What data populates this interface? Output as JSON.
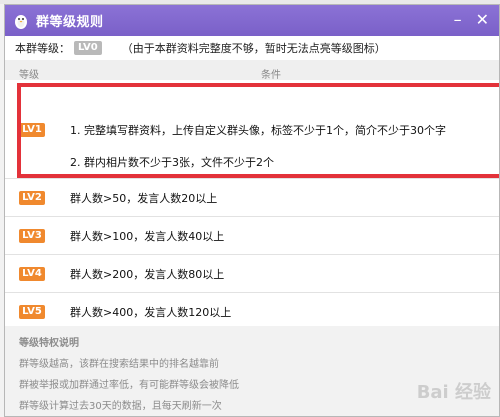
{
  "window": {
    "title": "群等级规则",
    "minimize_glyph": "–",
    "close_glyph": "✕"
  },
  "level_row": {
    "label": "本群等级：",
    "badge": "LV0",
    "note": "（由于本群资料完整度不够，暂时无法点亮等级图标）"
  },
  "table": {
    "headers": [
      "等级",
      "条件"
    ],
    "rows": [
      {
        "level": "LV1",
        "lines": [
          "1. 完整填写群资料，上传自定义群头像，标签不少于1个，简介不少于30个字",
          "2. 群内相片数不少于3张，文件不少于2个"
        ]
      },
      {
        "level": "LV2",
        "lines": [
          "群人数>50，发言人数20以上"
        ]
      },
      {
        "level": "LV3",
        "lines": [
          "群人数>100，发言人数40以上"
        ]
      },
      {
        "level": "LV4",
        "lines": [
          "群人数>200，发言人数80以上"
        ]
      },
      {
        "level": "LV5",
        "lines": [
          "群人数>400，发言人数120以上"
        ]
      }
    ]
  },
  "footer": {
    "heading": "等级特权说明",
    "lines": [
      "群等级越高，该群在搜索结果中的排名越靠前",
      "群被举报或加群通过率低，有可能群等级会被降低",
      "群等级计算过去30天的数据，且每天刷新一次"
    ]
  },
  "watermark": "Bai 经验",
  "colors": {
    "titlebar": "#7a60c8",
    "level_badge": "#f0892e",
    "highlight": "#e3323a"
  },
  "icons": {
    "title": "penguin-icon"
  }
}
